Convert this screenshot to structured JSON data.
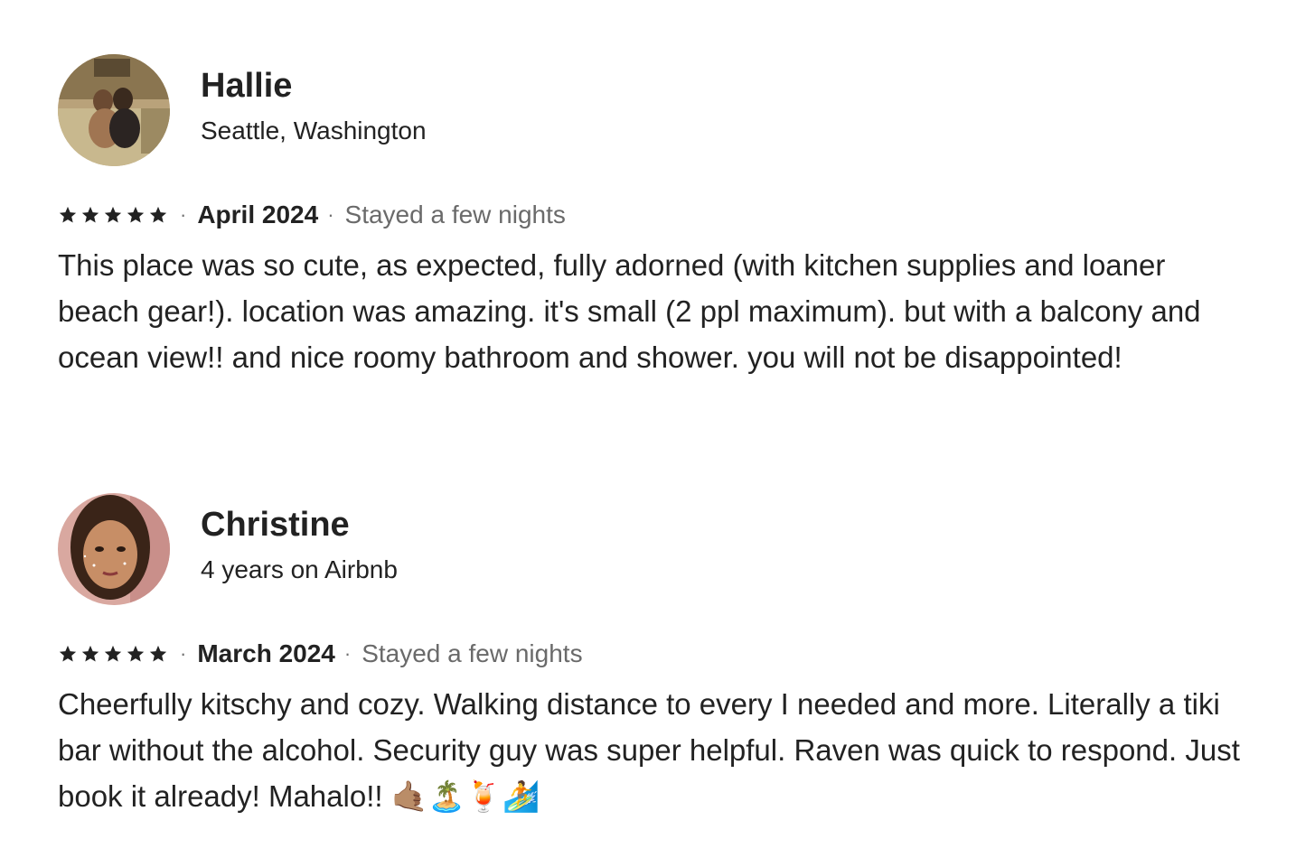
{
  "reviews": [
    {
      "name": "Hallie",
      "subtitle": "Seattle, Washington",
      "rating": 5,
      "separator": "·",
      "date": "April 2024",
      "stay": "Stayed a few nights",
      "text": "This place was so cute, as expected, fully adorned (with kitchen supplies and loaner beach gear!). location was amazing. it's small (2 ppl maximum). but with a balcony and ocean view!! and nice roomy bathroom and shower. you will not be disappointed!",
      "avatar_icon": "reviewer-photo-couple-on-couch"
    },
    {
      "name": "Christine",
      "subtitle": "4 years on Airbnb",
      "rating": 5,
      "separator": "·",
      "date": "March 2024",
      "stay": "Stayed a few nights",
      "text": "Cheerfully kitschy and cozy. Walking distance to every I needed and more. Literally a tiki bar without the alcohol. Security guy was super helpful. Raven was quick to respond. Just book it already! Mahalo!! 🤙🏽🏝️🍹🏄",
      "avatar_icon": "reviewer-photo-portrait"
    }
  ],
  "colors": {
    "text": "#222222",
    "secondary": "#6a6a6a",
    "star": "#222222"
  }
}
